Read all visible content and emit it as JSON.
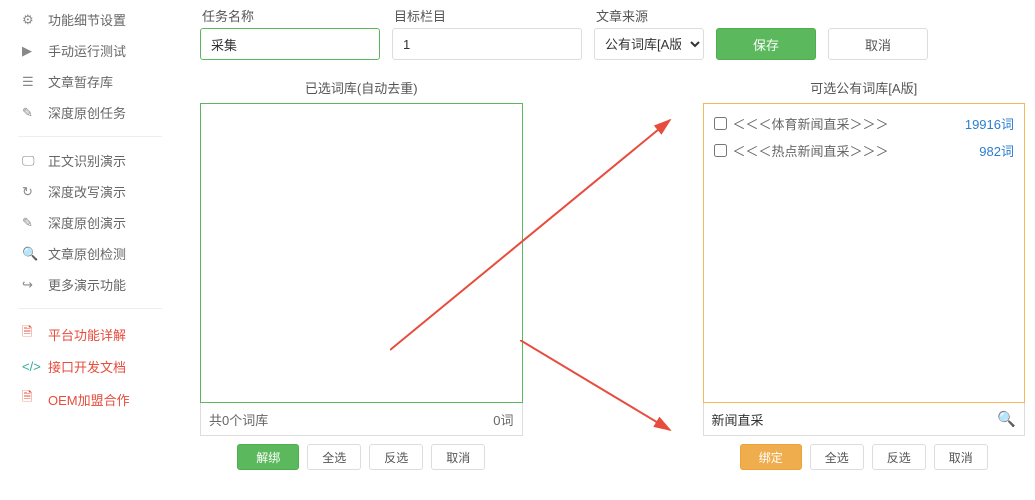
{
  "sidebar": {
    "items": [
      {
        "label": "功能细节设置"
      },
      {
        "label": "手动运行测试"
      },
      {
        "label": "文章暂存库"
      },
      {
        "label": "深度原创任务"
      },
      {
        "label": "正文识别演示"
      },
      {
        "label": "深度改写演示"
      },
      {
        "label": "深度原创演示"
      },
      {
        "label": "文章原创检测"
      },
      {
        "label": "更多演示功能"
      },
      {
        "label": "平台功能详解"
      },
      {
        "label": "接口开发文档"
      },
      {
        "label": "OEM加盟合作"
      }
    ]
  },
  "form": {
    "task_name_label": "任务名称",
    "task_name_value": "采集",
    "target_col_label": "目标栏目",
    "target_col_value": "1",
    "source_label": "文章来源",
    "source_value": "公有词库[A版]",
    "save_label": "保存",
    "cancel_label": "取消"
  },
  "left_panel": {
    "title": "已选词库(自动去重)",
    "count_label": "共0个词库",
    "word_total": "0词",
    "actions": {
      "unbind": "解绑",
      "all": "全选",
      "invert": "反选",
      "cancel": "取消"
    }
  },
  "right_panel": {
    "title": "可选公有词库[A版]",
    "items": [
      {
        "name": "＜＜＜体育新闻直采＞＞＞",
        "count": "19916词"
      },
      {
        "name": "＜＜＜热点新闻直采＞＞＞",
        "count": "982词"
      }
    ],
    "search_value": "新闻直采",
    "actions": {
      "bind": "绑定",
      "all": "全选",
      "invert": "反选",
      "cancel": "取消"
    }
  },
  "annotations": {
    "arrow1_note": "red arrow pointing from mid-left to top of right panel",
    "arrow2_note": "red arrow pointing from mid to search box of right panel"
  }
}
